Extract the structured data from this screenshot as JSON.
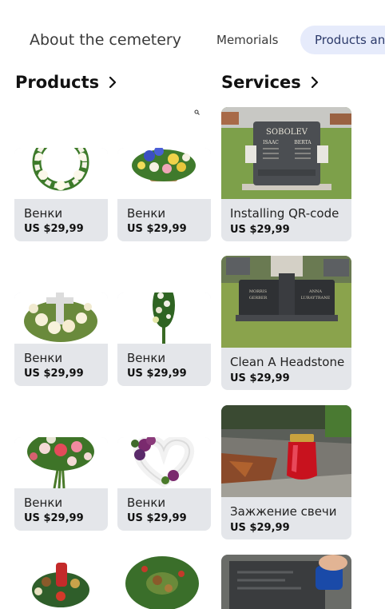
{
  "nav": {
    "tabs": [
      {
        "label": "About the cemetery"
      },
      {
        "label": "Memorials"
      },
      {
        "label": "Products and"
      }
    ]
  },
  "products": {
    "title": "Products",
    "items": [
      {
        "name": "Венки",
        "price": "US $29,99"
      },
      {
        "name": "Венки",
        "price": "US $29,99"
      },
      {
        "name": "Венки",
        "price": "US $29,99"
      },
      {
        "name": "Венки",
        "price": "US $29,99"
      },
      {
        "name": "Венки",
        "price": "US $29,99"
      },
      {
        "name": "Венки",
        "price": "US $29,99"
      }
    ]
  },
  "services": {
    "title": "Services",
    "items": [
      {
        "name": "Installing QR-code",
        "price": "US $29,99"
      },
      {
        "name": "Clean A Headstone",
        "price": "US $29,99"
      },
      {
        "name": "Зажжение свечи",
        "price": "US $29,99"
      }
    ],
    "headstone1": {
      "line1": "SOBOLEV",
      "line2": "ISAAC",
      "line3": "BERTA"
    },
    "headstone2": {
      "left1": "MORRIS",
      "left2": "GERBER",
      "right1": "ANNA",
      "right2": "LURAYTRANE"
    }
  },
  "colors": {
    "accent_tab": "#e6ebfb",
    "card_bg": "#e4e6ea"
  }
}
